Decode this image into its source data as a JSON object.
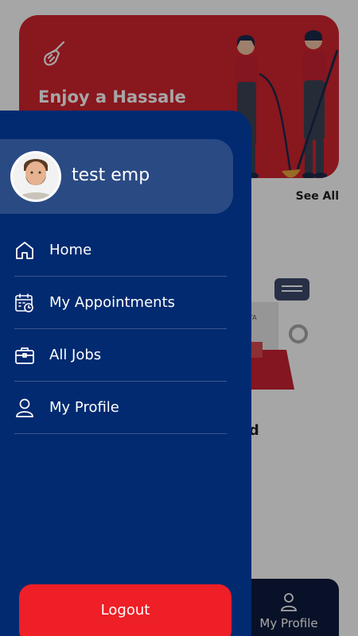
{
  "background": {
    "banner": {
      "title": "Enjoy a Hassale Free Service",
      "icon": "broom-icon",
      "color": "#d3242e"
    },
    "see_all": "See All",
    "service_name": "nd",
    "bottom_nav": {
      "profile_label": "My Profile",
      "profile_icon": "user-icon"
    }
  },
  "drawer": {
    "bg_color": "#022a70",
    "user": {
      "name": "test emp",
      "avatar": "avatar-photo"
    },
    "menu": [
      {
        "label": "Home",
        "icon": "home-icon"
      },
      {
        "label": "My Appointments",
        "icon": "calendar-clock-icon"
      },
      {
        "label": "All Jobs",
        "icon": "briefcase-icon"
      },
      {
        "label": "My Profile",
        "icon": "user-icon"
      }
    ],
    "logout_label": "Logout",
    "logout_color": "#ee1f26"
  }
}
